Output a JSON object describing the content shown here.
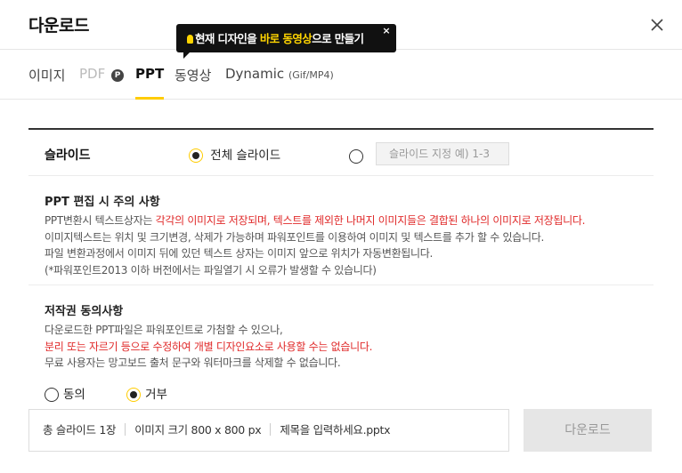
{
  "header": {
    "title": "다운로드",
    "close_icon": "close-icon"
  },
  "tooltip": {
    "part1": "현재 디자인을 ",
    "highlight": "바로 동영상",
    "part2": "으로 만들기",
    "close": "×",
    "highlight_color": "#ffd400"
  },
  "tabs": [
    {
      "label": "이미지"
    },
    {
      "label": "PDF",
      "badge": "P"
    },
    {
      "label": "PPT"
    },
    {
      "label": "동영상"
    },
    {
      "label": "Dynamic",
      "sub": "(Gif/MP4)"
    }
  ],
  "slide": {
    "label": "슬라이드",
    "all_option": "전체 슬라이드",
    "range_placeholder": "슬라이드 지정 예) 1-3"
  },
  "notes": {
    "title": "PPT 편집 시 주의 사항",
    "line1_a": "PPT변환시 텍스트상자는 ",
    "line1_b": "각각의 이미지로 저장되며, 텍스트를 제외한 나머지 이미지들은 결합된 하나의 이미지로 저장됩니다.",
    "line2": "이미지텍스트는 위치 및 크기변경, 삭제가 가능하며 파워포인트를 이용하여 이미지 및 텍스트를 추가 할 수 있습니다.",
    "line3": "파일 변환과정에서 이미지 뒤에 있던 텍스트 상자는 이미지 앞으로 위치가 자동변환됩니다.",
    "line4": "(*파워포인트2013 이하 버전에서는 파일열기 시 오류가 발생할 수 있습니다)"
  },
  "copyright": {
    "title": "저작권 동의사항",
    "line1": "다운로드한 PPT파일은 파워포인트로 가첨할 수 있으나,",
    "line2": "분리 또는 자르기 등으로 수정하여 개별 디자인요소로 사용할 수는 없습니다.",
    "line3": "무료 사용자는 망고보드 출처 문구와 워터마크를 삭제할 수 없습니다.",
    "agree": "동의",
    "decline": "거부"
  },
  "bottom": {
    "total": "총 슬라이드 1장",
    "size": "이미지 크기 800 x 800 px",
    "filename": "제목을 입력하세요.pptx",
    "download": "다운로드"
  },
  "colors": {
    "accent": "#ffcc00",
    "warning": "#e02a2a"
  }
}
